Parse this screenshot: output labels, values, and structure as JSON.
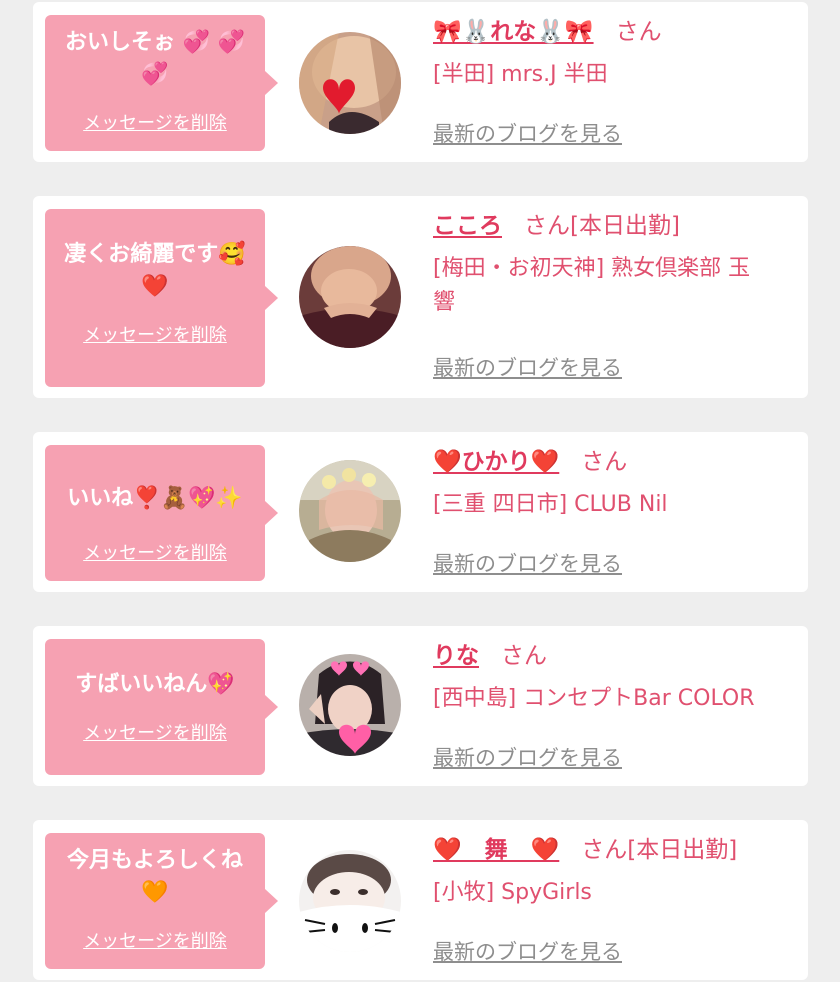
{
  "colors": {
    "page_bg": "#eeeeee",
    "bubble": "#f6a1b2",
    "name": "#e03a5e",
    "shop_text": "#e0506f",
    "blog_link": "#8e8e8e"
  },
  "delete_label": "メッセージを削除",
  "blog_label": "最新のブログを見る",
  "items": [
    {
      "message": "おいしそぉ 💞 💞\n💞",
      "name": "🎀🐰れな🐰🎀",
      "suffix": "さん",
      "shop": "[半田] mrs.J 半田",
      "avatar_icon": "profile-photo-heart-sticker"
    },
    {
      "message": "凄くお綺麗です🥰\n❤️",
      "name": "こころ",
      "suffix": "さん[本日出勤]",
      "shop": "[梅田・お初天神] 熟女倶楽部 玉\n響",
      "avatar_icon": "profile-photo"
    },
    {
      "message": "いいね❣️🧸💖✨",
      "name": "❤️ひかり❤️",
      "suffix": "さん",
      "shop": "[三重 四日市] CLUB Nil",
      "avatar_icon": "profile-photo-flower-crown"
    },
    {
      "message": "すばいいねん💖",
      "name": "りな",
      "suffix": "さん",
      "shop": "[西中島] コンセプトBar COLOR",
      "avatar_icon": "profile-photo-heart-sticker"
    },
    {
      "message": "今月もよろしくね\n🧡",
      "name": "❤️　舞　❤️",
      "suffix": "さん[本日出勤]",
      "shop": "[小牧] SpyGirls",
      "avatar_icon": "profile-photo-cat-mask"
    }
  ]
}
